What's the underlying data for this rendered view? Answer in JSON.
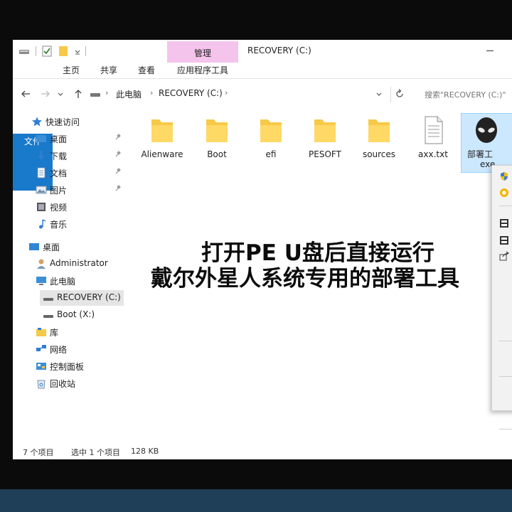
{
  "window": {
    "title": "RECOVERY (C:)",
    "manage_tab": "管理"
  },
  "ribbon": {
    "tabs": [
      "文件",
      "主页",
      "共享",
      "查看",
      "应用程序工具"
    ]
  },
  "address": {
    "crumbs": [
      "此电脑",
      "RECOVERY (C:)"
    ],
    "search_placeholder": "搜索\"RECOVERY (C:)\""
  },
  "navpane": {
    "items": [
      {
        "label": "快速访问",
        "icon": "star-icon"
      },
      {
        "label": "桌面",
        "icon": "desktop-icon",
        "pinned": true
      },
      {
        "label": "下载",
        "icon": "download-icon",
        "pinned": true
      },
      {
        "label": "文档",
        "icon": "document-icon",
        "pinned": true
      },
      {
        "label": "图片",
        "icon": "picture-icon",
        "pinned": true
      },
      {
        "label": "视频",
        "icon": "video-icon"
      },
      {
        "label": "音乐",
        "icon": "music-icon"
      },
      {
        "label": "桌面",
        "icon": "desktop-icon"
      },
      {
        "label": "Administrator",
        "icon": "user-icon"
      },
      {
        "label": "此电脑",
        "icon": "computer-icon"
      },
      {
        "label": "RECOVERY (C:)",
        "icon": "drive-icon",
        "selected": true
      },
      {
        "label": "Boot (X:)",
        "icon": "drive-icon"
      },
      {
        "label": "库",
        "icon": "library-icon"
      },
      {
        "label": "网络",
        "icon": "network-icon"
      },
      {
        "label": "控制面板",
        "icon": "control-panel-icon"
      },
      {
        "label": "回收站",
        "icon": "recycle-bin-icon"
      }
    ]
  },
  "files": [
    {
      "name": "Alienware",
      "icon": "folder-icon"
    },
    {
      "name": "Boot",
      "icon": "folder-icon"
    },
    {
      "name": "efi",
      "icon": "folder-icon"
    },
    {
      "name": "PESOFT",
      "icon": "folder-icon"
    },
    {
      "name": "sources",
      "icon": "folder-icon"
    },
    {
      "name": "axx.txt",
      "icon": "text-file-icon"
    },
    {
      "name": "部署工",
      "name_line2": "exe",
      "icon": "alien-head-icon",
      "selected": true
    }
  ],
  "status": {
    "item_count": "7 个项目",
    "selection": "选中 1 个项目",
    "size": "128 KB"
  },
  "overlay": {
    "line1": "打开PE U盘后直接运行",
    "line2": "戴尔外星人系统专用的部署工具"
  },
  "colors": {
    "accent": "#1979ca",
    "manage_tab": "#f5c4ec",
    "folder": "#f7c948",
    "selection": "#cce8ff"
  }
}
